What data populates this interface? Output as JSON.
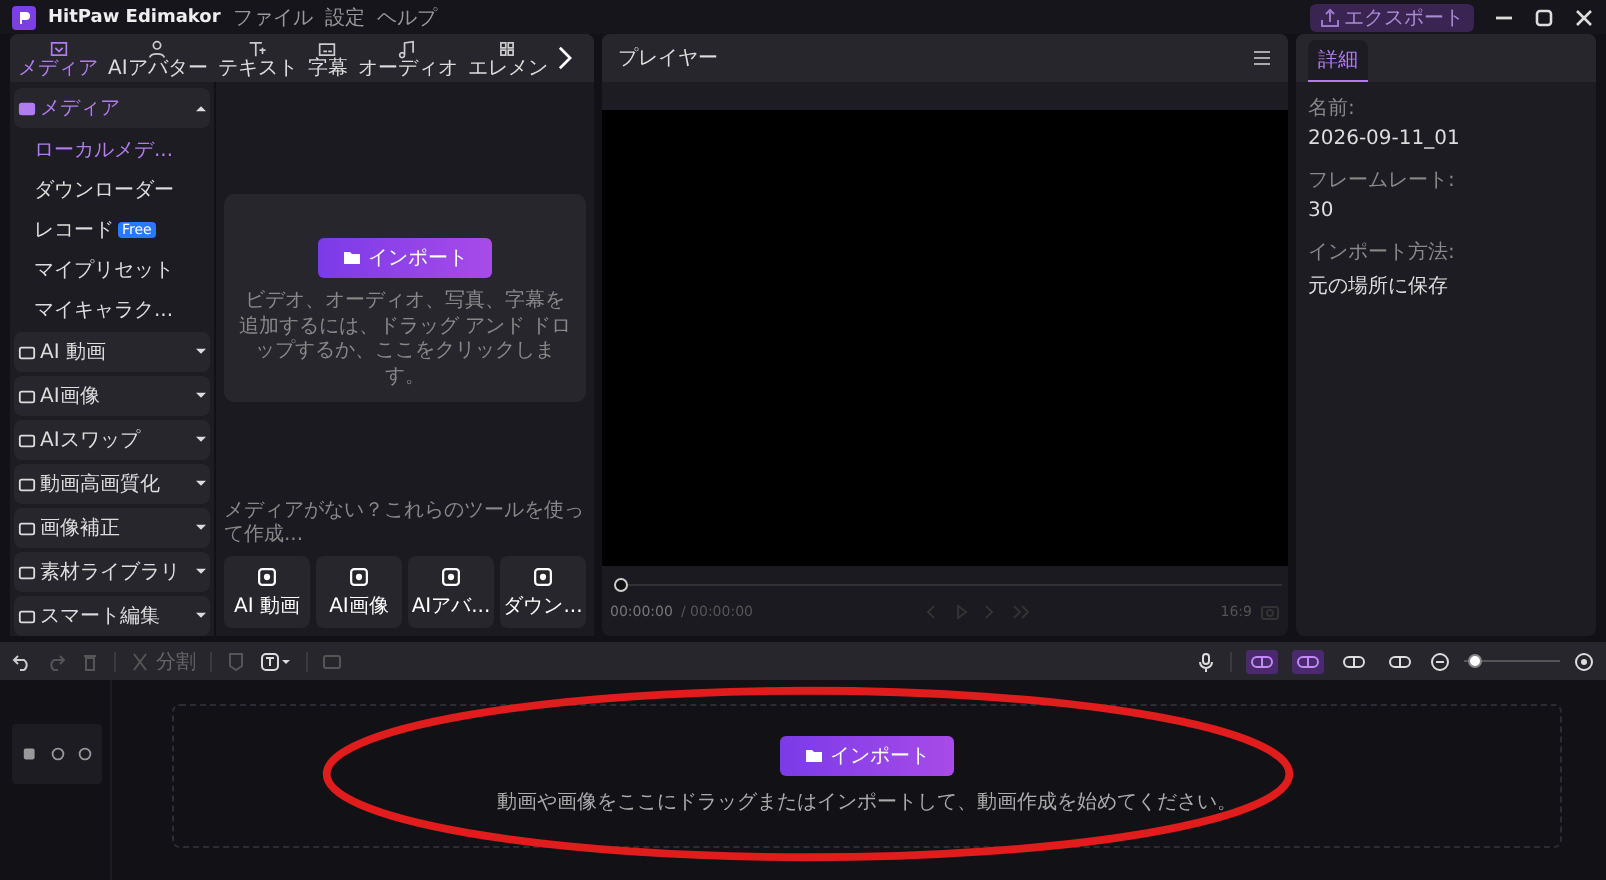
{
  "app": {
    "name": "HitPaw Edimakor",
    "menu": [
      "ファイル",
      "設定",
      "ヘルプ"
    ],
    "export_label": "エクスポート"
  },
  "tabs": [
    {
      "label": "メディア",
      "selected": true
    },
    {
      "label": "AIアバター",
      "selected": false
    },
    {
      "label": "テキスト",
      "selected": false
    },
    {
      "label": "字幕",
      "selected": false
    },
    {
      "label": "オーディオ",
      "selected": false
    },
    {
      "label": "エレメン",
      "selected": false
    }
  ],
  "sidebar": [
    {
      "label": "メディア",
      "expanded": true,
      "children": [
        {
          "label": "ローカルメデ...",
          "selected": true
        },
        {
          "label": "ダウンローダー",
          "selected": false
        },
        {
          "label": "レコード",
          "badge": "Free",
          "selected": false
        },
        {
          "label": "マイプリセット",
          "selected": false
        },
        {
          "label": "マイキャラク...",
          "selected": false
        }
      ]
    },
    {
      "label": "AI 動画",
      "expanded": false
    },
    {
      "label": "AI画像",
      "expanded": false
    },
    {
      "label": "AIスワップ",
      "expanded": false
    },
    {
      "label": "動画高画質化",
      "expanded": false
    },
    {
      "label": "画像補正",
      "expanded": false
    },
    {
      "label": "素材ライブラリ",
      "expanded": false
    },
    {
      "label": "スマート編集",
      "expanded": false
    }
  ],
  "media_panel": {
    "import_button": "インポート",
    "hint": "ビデオ、オーディオ、写真、字幕を追加するには、ドラッグ アンド ドロップするか、ここをクリックします。",
    "tools_hint": "メディアがない？これらのツールを使って作成...",
    "tools": [
      "AI 動画",
      "AI画像",
      "AIアバ...",
      "ダウン..."
    ]
  },
  "player": {
    "title": "プレイヤー",
    "time": "00:00:00",
    "duration": "/ 00:00:00",
    "ratio": "16:9",
    "level": 0
  },
  "details": {
    "tab": "詳細",
    "fields": [
      {
        "label": "名前:",
        "value": "2026-09-11_01"
      },
      {
        "label": "フレームレート:",
        "value": "30"
      },
      {
        "label": "インポート方法:",
        "value": "元の場所に保存"
      }
    ]
  },
  "toolbar": {
    "split_label": "分割",
    "toggles": [
      {
        "on": true
      },
      {
        "on": true
      },
      {
        "on": false
      },
      {
        "on": false
      }
    ],
    "zoom": {
      "level": 0.05
    }
  },
  "timeline": {
    "import_button": "インポート",
    "hint": "動画や画像をここにドラッグまたはインポートして、動画作成を始めてください。"
  },
  "annotation": {
    "kind": "ellipse"
  }
}
